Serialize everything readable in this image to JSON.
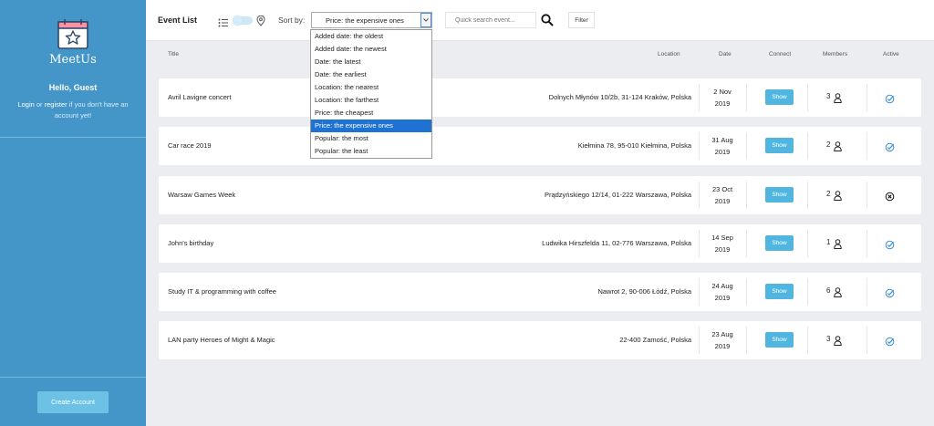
{
  "sidebar": {
    "brand": "MeetUs",
    "greeting": "Hello, Guest",
    "login_link": "Login",
    "or_text": " or ",
    "register_link": "register",
    "login_suffix": " if you don't have an account yet!",
    "create_button": "Create Account"
  },
  "header": {
    "title": "Event List",
    "sort_label": "Sort by:",
    "sort_value": "Price: the expensive ones",
    "search_placeholder": "Quick search event...",
    "filter_button": "Filter"
  },
  "sort_options": [
    "Added date: the oldest",
    "Added date: the newest",
    "Date: the latest",
    "Date: the earliest",
    "Location: the nearest",
    "Location: the farthest",
    "Price: the cheapest",
    "Price: the expensive ones",
    "Popular: the most",
    "Popular: the least"
  ],
  "selected_option_index": 7,
  "columns": {
    "title": "Title",
    "location": "Location",
    "date": "Date",
    "connect": "Connect",
    "members": "Members",
    "active": "Active"
  },
  "events": [
    {
      "title": "Avril Lavigne concert",
      "location": "Dolnych Młynów 10/2b, 31-124 Kraków, Polska",
      "date_day": "2 Nov",
      "date_year": "2019",
      "button": "Show",
      "members": "3",
      "active": true
    },
    {
      "title": "Car race 2019",
      "location": "Kiełmina 78, 95-010 Kiełmina, Polska",
      "date_day": "31 Aug",
      "date_year": "2019",
      "button": "Show",
      "members": "2",
      "active": true
    },
    {
      "title": "Warsaw Games Week",
      "location": "Prądzyńskiego 12/14, 01-222 Warszawa, Polska",
      "date_day": "23 Oct",
      "date_year": "2019",
      "button": "Show",
      "members": "2",
      "active": false
    },
    {
      "title": "John's birthday",
      "location": "Ludwika Hirszfelda 11, 02-776 Warszawa, Polska",
      "date_day": "14 Sep",
      "date_year": "2019",
      "button": "Show",
      "members": "1",
      "active": true
    },
    {
      "title": "Study IT & programming with coffee",
      "location": "Nawrot 2, 90-006 Łódź, Polska",
      "date_day": "24 Aug",
      "date_year": "2019",
      "button": "Show",
      "members": "6",
      "active": true
    },
    {
      "title": "LAN party Heroes of Might & Magic",
      "location": "22-400 Zamość, Polska",
      "date_day": "23 Aug",
      "date_year": "2019",
      "button": "Show",
      "members": "3",
      "active": true
    }
  ],
  "colors": {
    "sidebar": "#4596c8",
    "accent": "#51b6df",
    "selected_option": "#1e73d2",
    "logo_pink": "#ff8fa3"
  }
}
